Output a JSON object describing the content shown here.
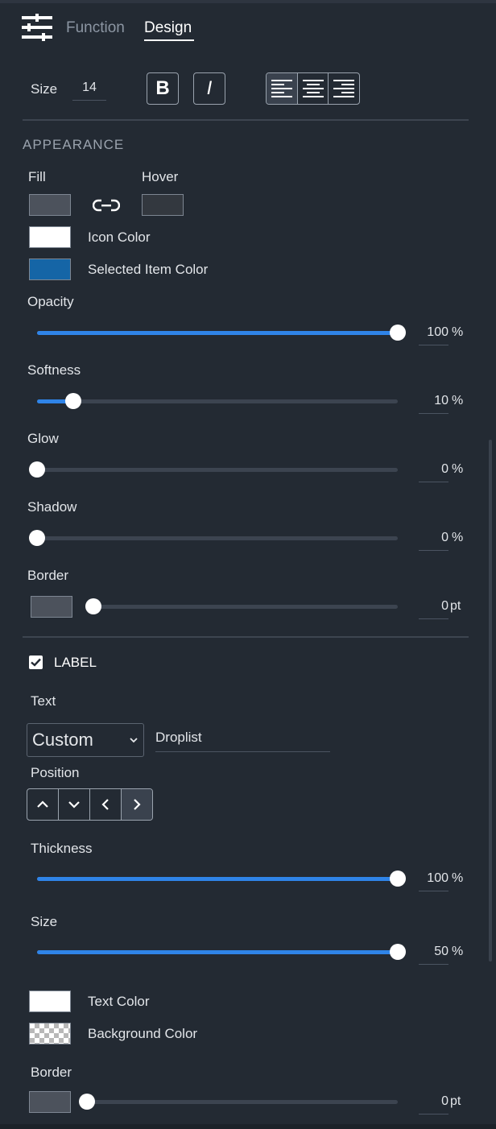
{
  "tabs": {
    "function_label": "Function",
    "design_label": "Design",
    "active": "Design"
  },
  "font": {
    "size_label": "Size",
    "size_value": "14",
    "bold_label": "B",
    "italic_label": "I",
    "alignment_selected": "left"
  },
  "appearance": {
    "title": "APPEARANCE",
    "fill_label": "Fill",
    "hover_label": "Hover",
    "fill_color": "#4c525c",
    "hover_color": "#33383f",
    "icon_color_label": "Icon Color",
    "icon_color": "#ffffff",
    "selected_item_color_label": "Selected Item Color",
    "selected_item_color": "#1565a6",
    "opacity": {
      "label": "Opacity",
      "value": "100",
      "unit": "%"
    },
    "softness": {
      "label": "Softness",
      "value": "10",
      "unit": "%"
    },
    "glow": {
      "label": "Glow",
      "value": "0",
      "unit": "%"
    },
    "shadow": {
      "label": "Shadow",
      "value": "0",
      "unit": "%"
    },
    "border": {
      "label": "Border",
      "value": "0",
      "unit": "pt",
      "color": "#4c525c"
    }
  },
  "label_section": {
    "checkbox_label": "LABEL",
    "checked": true,
    "text_label": "Text",
    "text_mode": "Custom",
    "text_value": "Droplist",
    "position_label": "Position",
    "position_selected": "right",
    "thickness": {
      "label": "Thickness",
      "value": "100",
      "unit": "%"
    },
    "size": {
      "label": "Size",
      "value": "50",
      "unit": "%"
    },
    "text_color_label": "Text Color",
    "text_color": "#ffffff",
    "background_color_label": "Background Color",
    "border": {
      "label": "Border",
      "value": "0",
      "unit": "pt",
      "color": "#4c525c"
    }
  },
  "colors": {
    "panel_bg": "#232a33",
    "accent": "#2f84e8",
    "track": "#3c4450"
  }
}
